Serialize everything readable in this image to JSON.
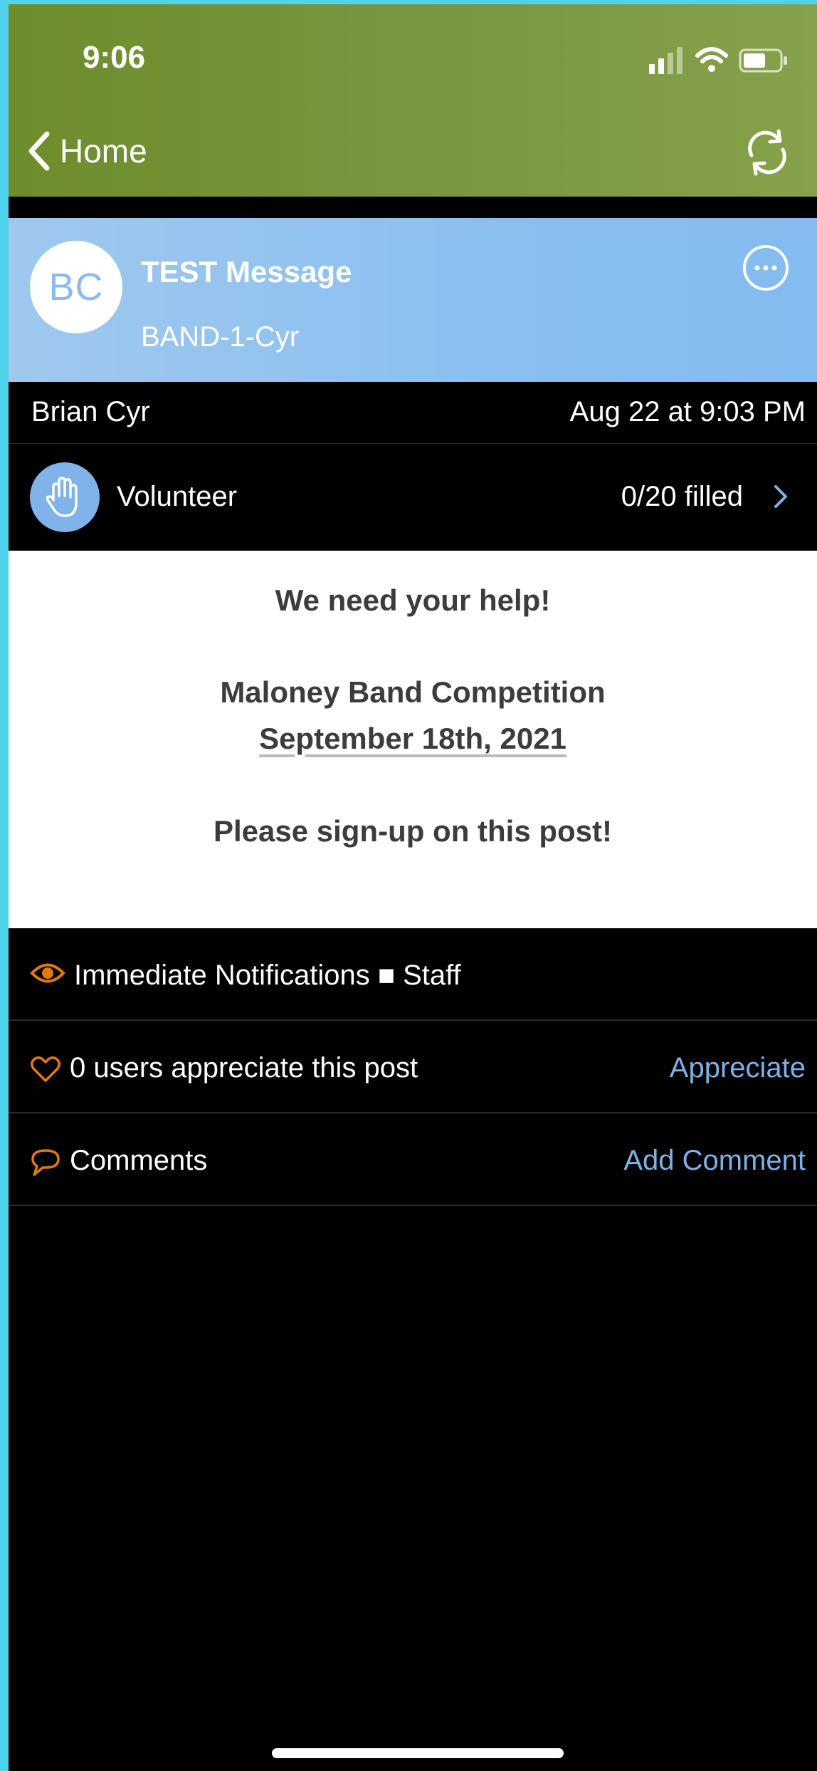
{
  "status_bar": {
    "time": "9:06"
  },
  "nav": {
    "back_label": "Home"
  },
  "message": {
    "avatar_initials": "BC",
    "title": "TEST Message",
    "group": "BAND-1-Cyr",
    "author": "Brian Cyr",
    "posted_at": "Aug 22 at 9:03 PM"
  },
  "volunteer": {
    "label": "Volunteer",
    "count": "0/20 filled"
  },
  "body": {
    "line1": "We need your help!",
    "line2": "Maloney Band Competition",
    "line3": "September 18th, 2021",
    "line4": "Please sign-up on this post!"
  },
  "notifications": {
    "text": "Immediate Notifications ■ Staff"
  },
  "appreciation": {
    "text": "0 users appreciate this post",
    "action": "Appreciate"
  },
  "comments": {
    "label": "Comments",
    "action": "Add Comment"
  },
  "colors": {
    "header_green": "#7a9842",
    "message_header_blue": "#8bbff0",
    "accent_orange": "#e07a10",
    "link_blue": "#7eb2e6"
  }
}
